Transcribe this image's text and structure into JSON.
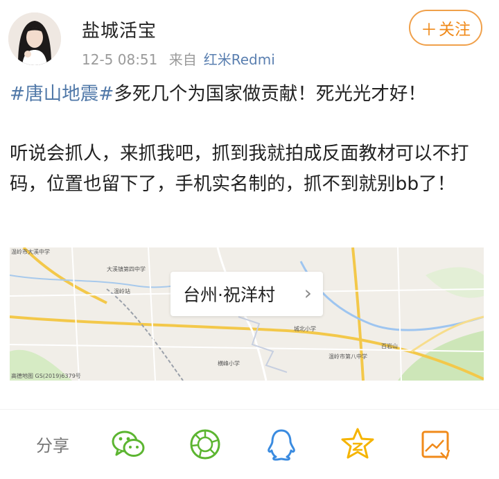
{
  "header": {
    "user_name": "盐城活宝",
    "time": "12-5 08:51",
    "source_prefix": "来自",
    "source_device": "红米Redmi",
    "follow_label": "关注"
  },
  "post": {
    "hashtag": "#唐山地震#",
    "line1_rest": "多死几个为国家做贡献！死光光才好！",
    "para2": "听说会抓人，来抓我吧，抓到我就拍成反面教材可以不打码，位置也留下了，手机实名制的，抓不到就别bb了！"
  },
  "location": {
    "label": "台州·祝洋村"
  },
  "map": {
    "labels": {
      "school1": "大溪镇第四中学",
      "station": "温岭站",
      "primary_school": "城北小学",
      "school8": "温岭市第八中学",
      "hill": "百岩山",
      "school3": "横峰小学",
      "top_left": "温岭市大溪中学",
      "copyright": "高德地图 GS(2019)6379号"
    }
  },
  "share": {
    "label": "分享",
    "icons": [
      "wechat-icon",
      "moments-icon",
      "qq-icon",
      "qzone-icon",
      "weibo-icon"
    ]
  },
  "colors": {
    "accent": "#f08a1a",
    "link": "#5078a8",
    "green": "#5cb531",
    "qq_blue": "#3a8be0",
    "qzone_yellow": "#f5b400"
  }
}
